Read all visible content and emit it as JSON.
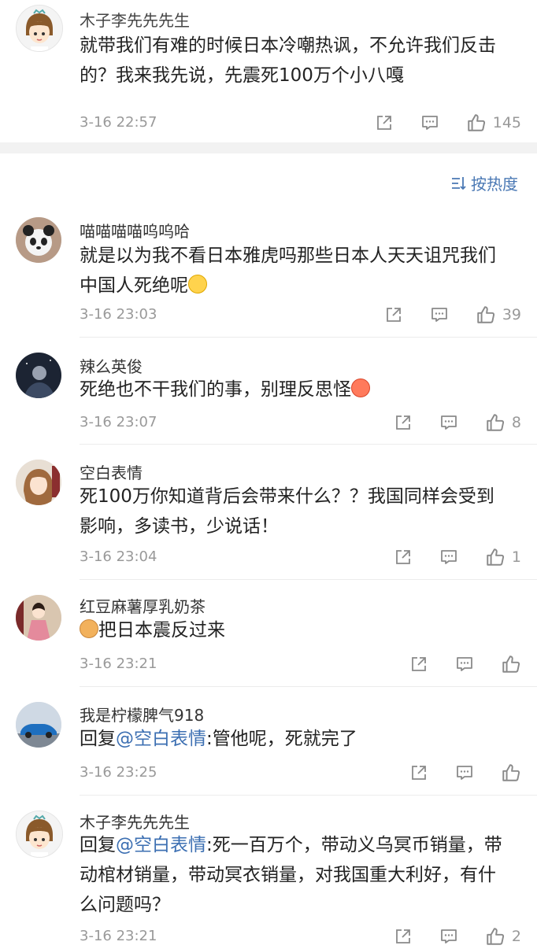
{
  "top_comment": {
    "user": "木子李先先先生",
    "text_line1": "就带我们有难的时候日本冷嘲热讽，不允许我们反击",
    "text_line2": "的？我来我先说，先震死100万个小八嘎",
    "time": "3-16 22:57",
    "likes": "145"
  },
  "sort": {
    "label": "按热度",
    "icon": "sort-icon"
  },
  "comments": [
    {
      "user": "喵喵喵喵呜呜哈",
      "text_line1": "就是以为我不看日本雅虎吗那些日本人天天诅咒我们",
      "text_line2": "中国人死绝呢",
      "time": "3-16 23:03",
      "likes": "39"
    },
    {
      "user": "辣么英俊",
      "text": "死绝也不干我们的事，别理反思怪",
      "time": "3-16 23:07",
      "likes": "8"
    },
    {
      "user": "空白表情",
      "text_line1": "死100万你知道背后会带来什么？？我国同样会受到",
      "text_line2": "影响，多读书，少说话！",
      "time": "3-16 23:04",
      "likes": "1"
    },
    {
      "user": "红豆麻薯厚乳奶茶",
      "text": "把日本震反过来",
      "time": "3-16 23:21",
      "likes": ""
    },
    {
      "user": "我是柠檬脾气918",
      "reply_prefix": "回复",
      "mention": "@空白表情",
      "text": ":管他呢，死就完了",
      "time": "3-16 23:25",
      "likes": ""
    },
    {
      "user": "木子李先先先生",
      "reply_prefix": "回复",
      "mention": "@空白表情",
      "text_line1": ":死一百万个，带动义乌冥币销量，带",
      "text_line2": "动棺材销量，带动冥衣销量，对我国重大利好，有什",
      "text_line3": "么问题吗？",
      "time": "3-16 23:21",
      "likes": "2"
    }
  ],
  "icons": [
    "share-icon",
    "comment-icon",
    "like-icon"
  ]
}
